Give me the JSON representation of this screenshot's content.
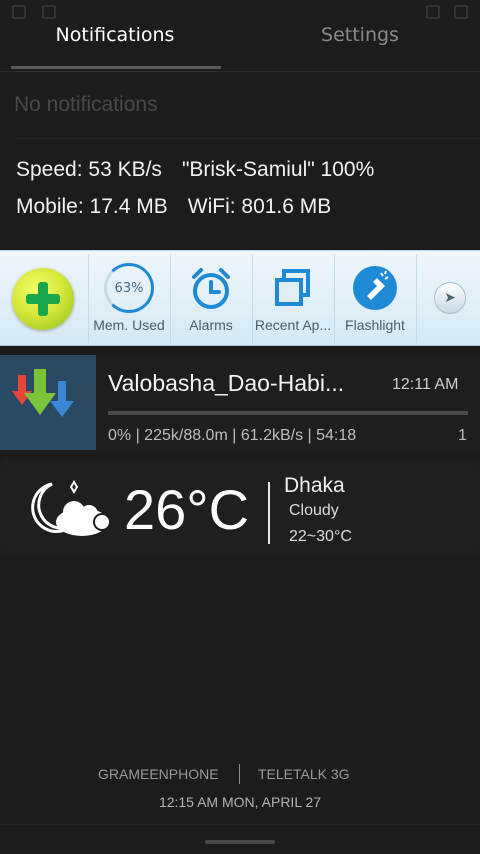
{
  "tabs": [
    {
      "label": "Notifications"
    },
    {
      "label": "Settings"
    }
  ],
  "status": {
    "no_notifications": "No notifications",
    "speed_label": "Speed: 53 KB/s",
    "network_label": "\"Brisk-Samiul\" 100%",
    "mobile_label": "Mobile: 17.4 MB",
    "wifi_label": "WiFi: 801.6 MB"
  },
  "quickbar": {
    "items": [
      {
        "label": "Mem. Used",
        "value": "63%",
        "icon": "memory-gauge-icon"
      },
      {
        "label": "Alarms",
        "icon": "alarm-clock-icon"
      },
      {
        "label": "Recent Ap...",
        "icon": "recent-apps-icon"
      },
      {
        "label": "Flashlight",
        "icon": "flashlight-icon"
      }
    ],
    "more_icon": "chevron-right-icon",
    "logo_icon": "cleaner-plus-icon"
  },
  "download": {
    "title": "Valobasha_Dao-Habi...",
    "time": "12:11 AM",
    "progress": 0,
    "stats": "0% | 225k/88.0m | 61.2kB/s | 54:18",
    "count": "1",
    "icon": "download-arrows-icon"
  },
  "weather": {
    "temperature": "26°C",
    "city": "Dhaka",
    "condition": "Cloudy",
    "range": "22~30°C",
    "icon": "cloudy-night-icon"
  },
  "footer": {
    "carrier1": "GRAMEENPHONE",
    "carrier2": "TELETALK 3G",
    "datetime": "12:15 AM  MON, APRIL 27"
  },
  "colors": {
    "background": "#1c1c1c",
    "quickbar_bg": "#e4f0f7",
    "accent_blue": "#1e8ad6"
  }
}
